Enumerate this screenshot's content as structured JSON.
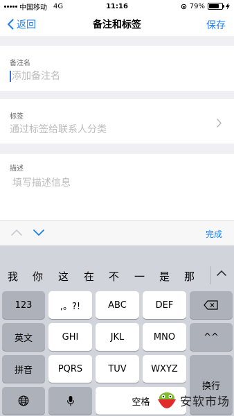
{
  "status_bar": {
    "carrier": "中国移动",
    "network": "4G",
    "time": "11:16",
    "battery": "79%",
    "battery_level": 0.79
  },
  "nav": {
    "back_label": "返回",
    "title": "备注和标签",
    "save_label": "保存"
  },
  "form": {
    "remark": {
      "label": "备注名",
      "placeholder": "添加备注名"
    },
    "tags": {
      "label": "标签",
      "placeholder": "通过标签给联系人分类"
    },
    "description": {
      "label": "描述",
      "placeholder": "填写描述信息"
    }
  },
  "accessory_bar": {
    "done_label": "完成"
  },
  "keyboard": {
    "candidates": [
      "我",
      "你",
      "这",
      "在",
      "不",
      "一",
      "是",
      "那"
    ],
    "keys": {
      "k123": "123",
      "punct": ",。?!",
      "abc": "ABC",
      "def": "DEF",
      "english": "英文",
      "ghi": "GHI",
      "jkl": "JKL",
      "mno": "MNO",
      "face": "^^",
      "pinyin": "拼音",
      "pqrs": "PQRS",
      "tuv": "TUV",
      "wxyz": "WXYZ",
      "newline": "换行",
      "space": "空格"
    }
  },
  "watermark": {
    "text": "安软市场"
  }
}
